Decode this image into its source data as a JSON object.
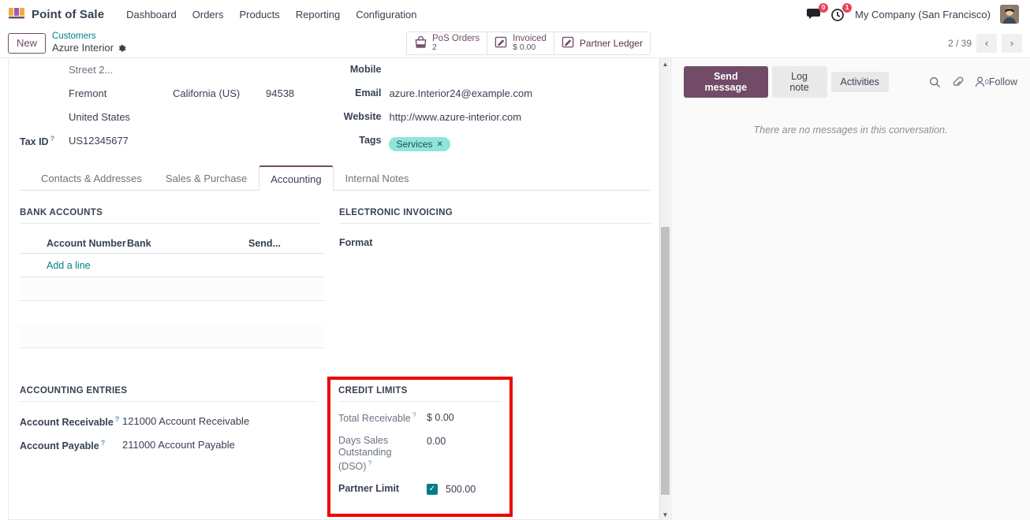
{
  "navbar": {
    "brand": "Point of Sale",
    "brand_icon": "pos-shop-icon",
    "menu": [
      "Dashboard",
      "Orders",
      "Products",
      "Reporting",
      "Configuration"
    ],
    "messages_badge": "0",
    "activities_badge": "1",
    "company": "My Company (San Francisco)",
    "avatar_alt": "user-avatar"
  },
  "control_panel": {
    "new_label": "New",
    "breadcrumb_parent": "Customers",
    "breadcrumb_current": "Azure Interior",
    "stat_buttons": [
      {
        "label": "PoS Orders",
        "value": "2",
        "icon": "shopping-bag-icon"
      },
      {
        "label": "Invoiced",
        "value": "$ 0.00",
        "icon": "pencil-square-icon"
      },
      {
        "label": "Partner Ledger",
        "value": "",
        "icon": "pencil-square-icon"
      }
    ],
    "pager": "2 / 39",
    "prev_icon": "chevron-left-icon",
    "next_icon": "chevron-right-icon"
  },
  "form": {
    "address": {
      "street2_clipped": "Street 2...",
      "city": "Fremont",
      "state": "California (US)",
      "zip": "94538",
      "country": "United States"
    },
    "tax_id_label": "Tax ID",
    "tax_id_value": "US12345677",
    "mobile_label": "Mobile",
    "mobile_value": "",
    "email_label": "Email",
    "email_value": "azure.Interior24@example.com",
    "website_label": "Website",
    "website_value": "http://www.azure-interior.com",
    "tags_label": "Tags",
    "tags": [
      "Services"
    ]
  },
  "notebook": {
    "tabs": [
      {
        "label": "Contacts & Addresses",
        "active": false
      },
      {
        "label": "Sales & Purchase",
        "active": false
      },
      {
        "label": "Accounting",
        "active": true
      },
      {
        "label": "Internal Notes",
        "active": false
      }
    ]
  },
  "accounting_tab": {
    "bank_accounts": {
      "title": "BANK ACCOUNTS",
      "columns": [
        "Account Number",
        "Bank",
        "Send..."
      ],
      "rows": [],
      "add_line": "Add a line"
    },
    "electronic_invoicing": {
      "title": "ELECTRONIC INVOICING",
      "format_label": "Format",
      "format_value": ""
    },
    "accounting_entries": {
      "title": "ACCOUNTING ENTRIES",
      "account_receivable_label": "Account Receivable",
      "account_receivable_value": "121000 Account Receivable",
      "account_payable_label": "Account Payable",
      "account_payable_value": "211000 Account Payable"
    },
    "credit_limits": {
      "title": "CREDIT LIMITS",
      "total_receivable_label": "Total Receivable",
      "total_receivable_value": "$ 0.00",
      "dso_label": "Days Sales Outstanding (DSO)",
      "dso_value": "0.00",
      "partner_limit_label": "Partner Limit",
      "partner_limit_checked": true,
      "partner_limit_value": "500.00",
      "highlight_color": "#ee0000"
    }
  },
  "chatter": {
    "send_message": "Send message",
    "log_note": "Log note",
    "activities": "Activities",
    "search_icon": "search-icon",
    "attachment_icon": "paperclip-icon",
    "followers_icon": "user-icon",
    "followers_count": "0",
    "follow_label": "Follow",
    "empty_text": "There are no messages in this conversation."
  },
  "theme": {
    "primary": "#714b67",
    "link": "#017e84",
    "badge_red": "#e7455b",
    "tag_bg": "#8ee5d8"
  }
}
